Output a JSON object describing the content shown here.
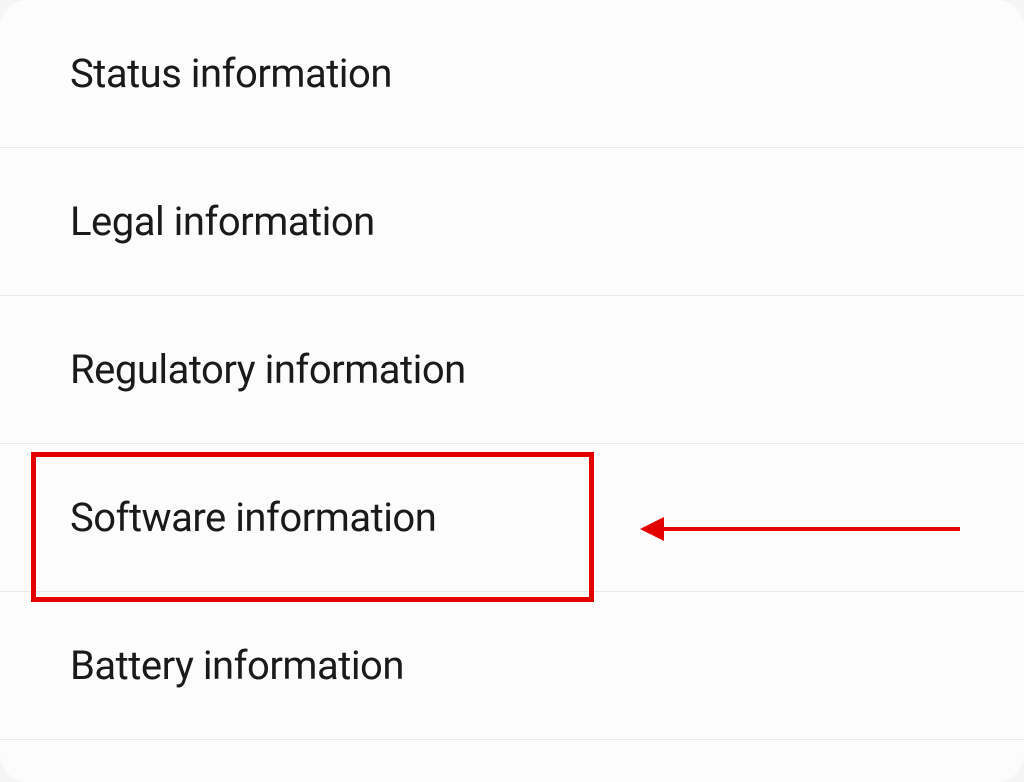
{
  "settings": {
    "items": [
      {
        "label": "Status information"
      },
      {
        "label": "Legal information"
      },
      {
        "label": "Regulatory information"
      },
      {
        "label": "Software information"
      },
      {
        "label": "Battery information"
      }
    ]
  },
  "annotation": {
    "highlight_color": "#e30000",
    "highlighted_index": 3
  }
}
